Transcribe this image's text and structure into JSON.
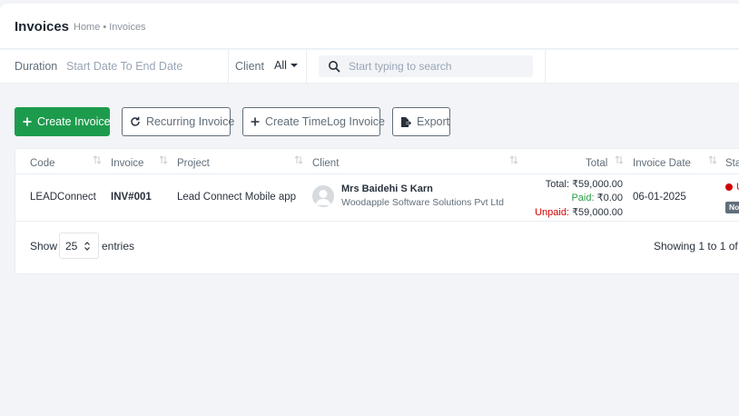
{
  "header": {
    "title": "Invoices",
    "breadcrumb": [
      "Home",
      "Invoices"
    ],
    "breadcrumb_sep": "•"
  },
  "filters": {
    "duration_label": "Duration",
    "duration_value": "Start Date To End Date",
    "client_label": "Client",
    "client_value": "All",
    "search_placeholder": "Start typing to search"
  },
  "actions": {
    "create_invoice": "Create Invoice",
    "recurring_invoice": "Recurring Invoice",
    "create_timelog_invoice": "Create TimeLog Invoice",
    "export": "Export"
  },
  "table": {
    "columns": [
      "Code",
      "Invoice",
      "Project",
      "Client",
      "Total",
      "Invoice Date",
      "Sta"
    ],
    "rows": [
      {
        "code": "LEADConnect",
        "invoice": "INV#001",
        "project": "Lead Connect Mobile app",
        "client_name": "Mrs Baidehi S Karn",
        "client_company": "Woodapple Software Solutions Pvt Ltd",
        "total_label": "Total:",
        "total": "₹59,000.00",
        "paid_label": "Paid:",
        "paid": "₹0.00",
        "unpaid_label": "Unpaid:",
        "unpaid": "₹59,000.00",
        "invoice_date": "06-01-2025",
        "status": "U",
        "badge": "No"
      }
    ]
  },
  "pagination": {
    "show_label": "Show",
    "page_size": "25",
    "entries_label": "entries",
    "showing": "Showing 1 to 1 of"
  },
  "colors": {
    "primary": "#1d9b4d",
    "paid": "#2a9d45",
    "unpaid": "#d30000"
  }
}
